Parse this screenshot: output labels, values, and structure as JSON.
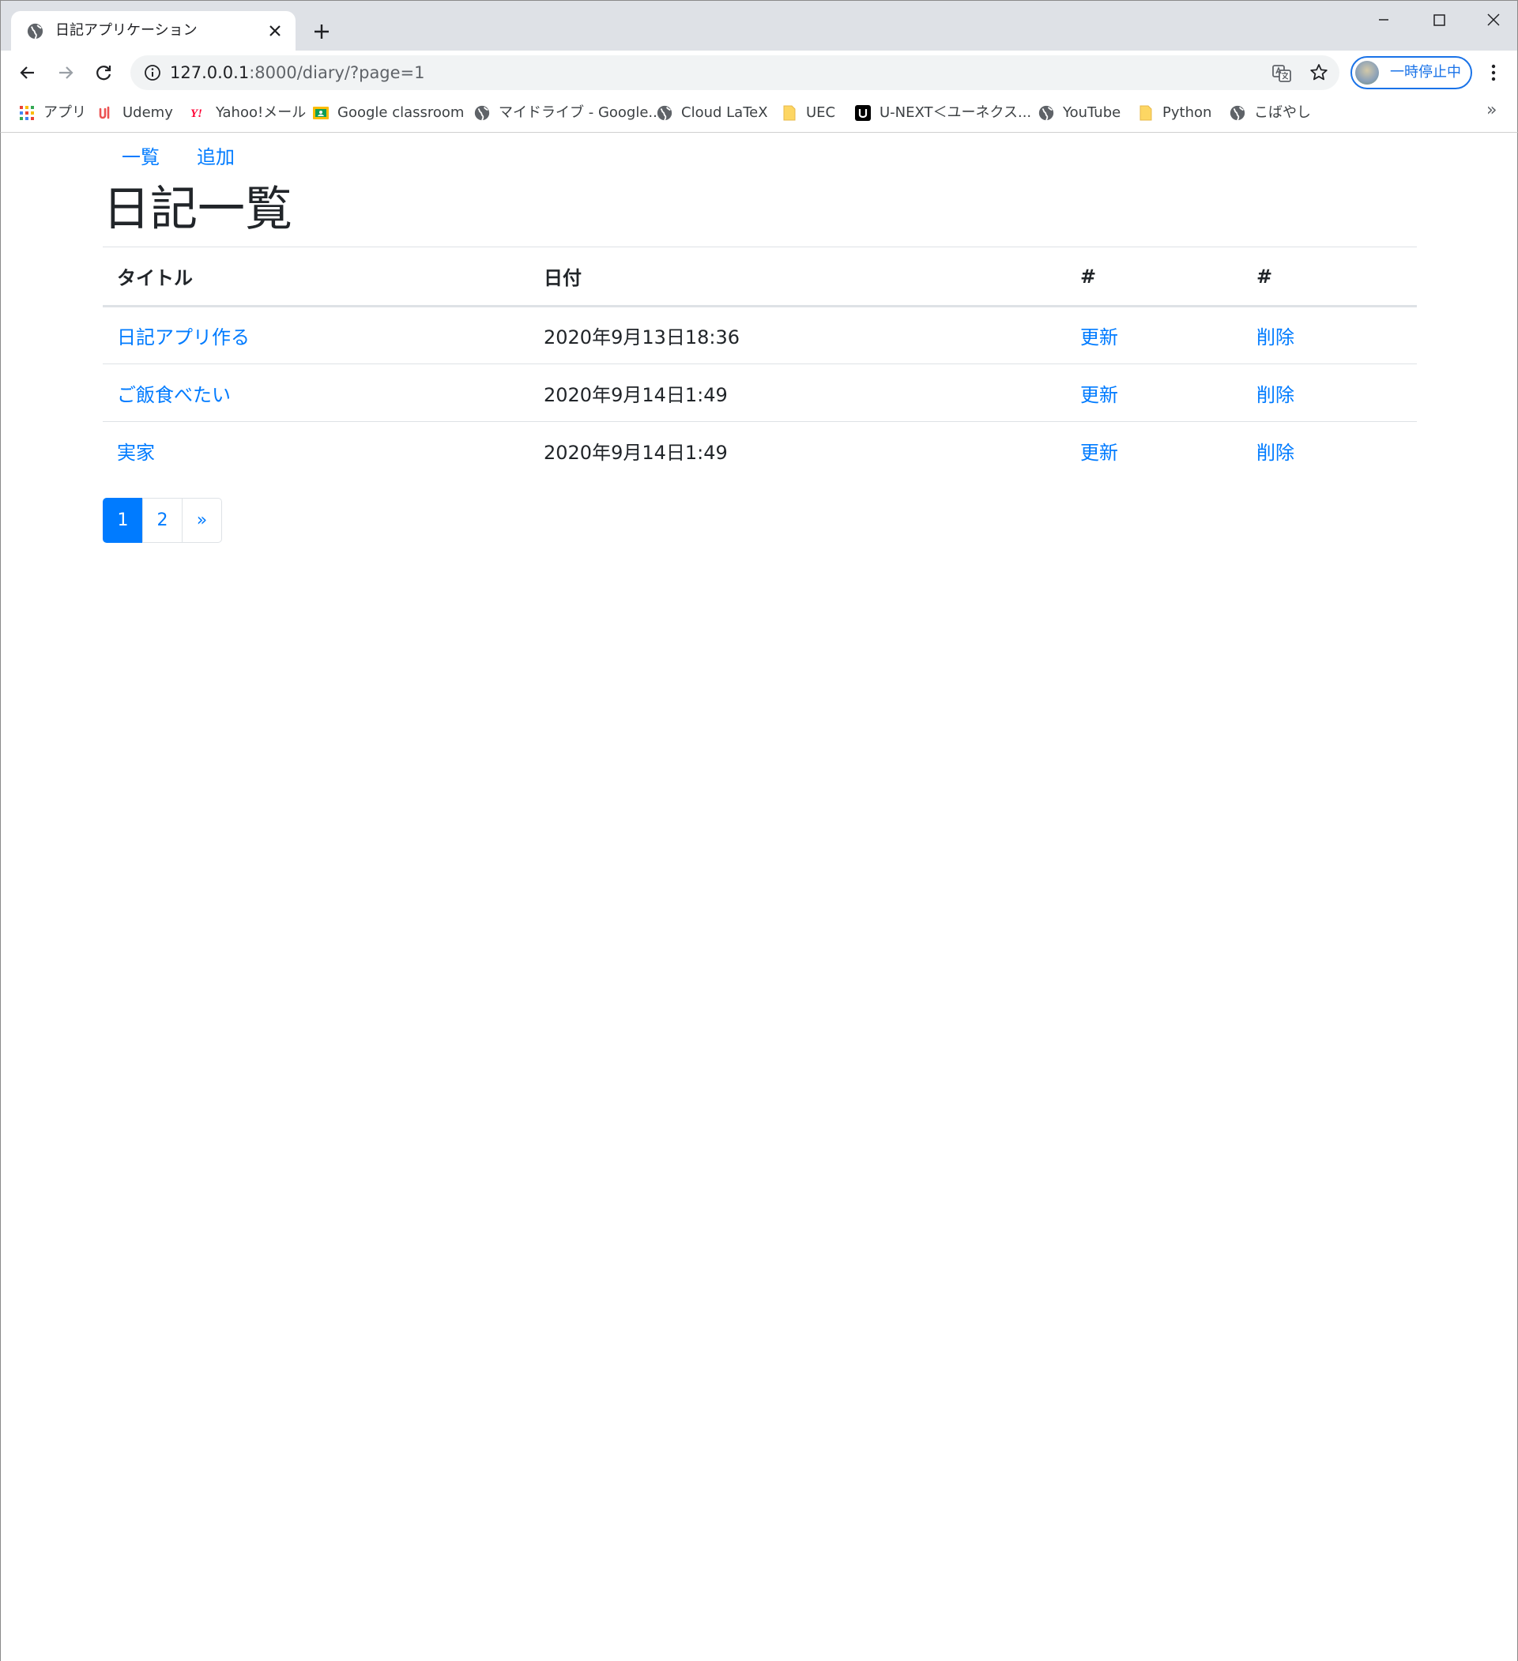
{
  "browser": {
    "tab": {
      "title": "日記アプリケーション"
    },
    "address": {
      "host": "127.0.0.1",
      "path": ":8000/diary/?page=1"
    },
    "profile": {
      "label": "一時停止中"
    },
    "bookmarks": [
      {
        "label": "アプリ",
        "icon": "apps-grid-icon"
      },
      {
        "label": "Udemy",
        "icon": "udemy-icon"
      },
      {
        "label": "Yahoo!メール",
        "icon": "yahoo-icon"
      },
      {
        "label": "Google classroom",
        "icon": "classroom-icon"
      },
      {
        "label": "マイドライブ - Google...",
        "icon": "globe-icon"
      },
      {
        "label": "Cloud LaTeX",
        "icon": "globe-icon"
      },
      {
        "label": "UEC",
        "icon": "folder-icon"
      },
      {
        "label": "U-NEXT＜ユーネクス...",
        "icon": "unext-icon"
      },
      {
        "label": "YouTube",
        "icon": "globe-icon"
      },
      {
        "label": "Python",
        "icon": "folder-icon"
      },
      {
        "label": "こばやし",
        "icon": "globe-icon"
      }
    ],
    "bookmarks_more": "»"
  },
  "page": {
    "nav": {
      "list": "一覧",
      "add": "追加"
    },
    "title": "日記一覧",
    "table": {
      "headers": {
        "title": "タイトル",
        "date": "日付",
        "update": "#",
        "delete": "#"
      },
      "rows": [
        {
          "title": "日記アプリ作る",
          "date": "2020年9月13日18:36",
          "update": "更新",
          "delete": "削除"
        },
        {
          "title": "ご飯食べたい",
          "date": "2020年9月14日1:49",
          "update": "更新",
          "delete": "削除"
        },
        {
          "title": "実家",
          "date": "2020年9月14日1:49",
          "update": "更新",
          "delete": "削除"
        }
      ]
    },
    "pagination": {
      "current": "1",
      "next_page": "2",
      "next": "»"
    }
  },
  "colors": {
    "link": "#007bff",
    "active_page": "#007bff",
    "profile_accent": "#1a73e8",
    "chrome_bg": "#dee1e6"
  }
}
